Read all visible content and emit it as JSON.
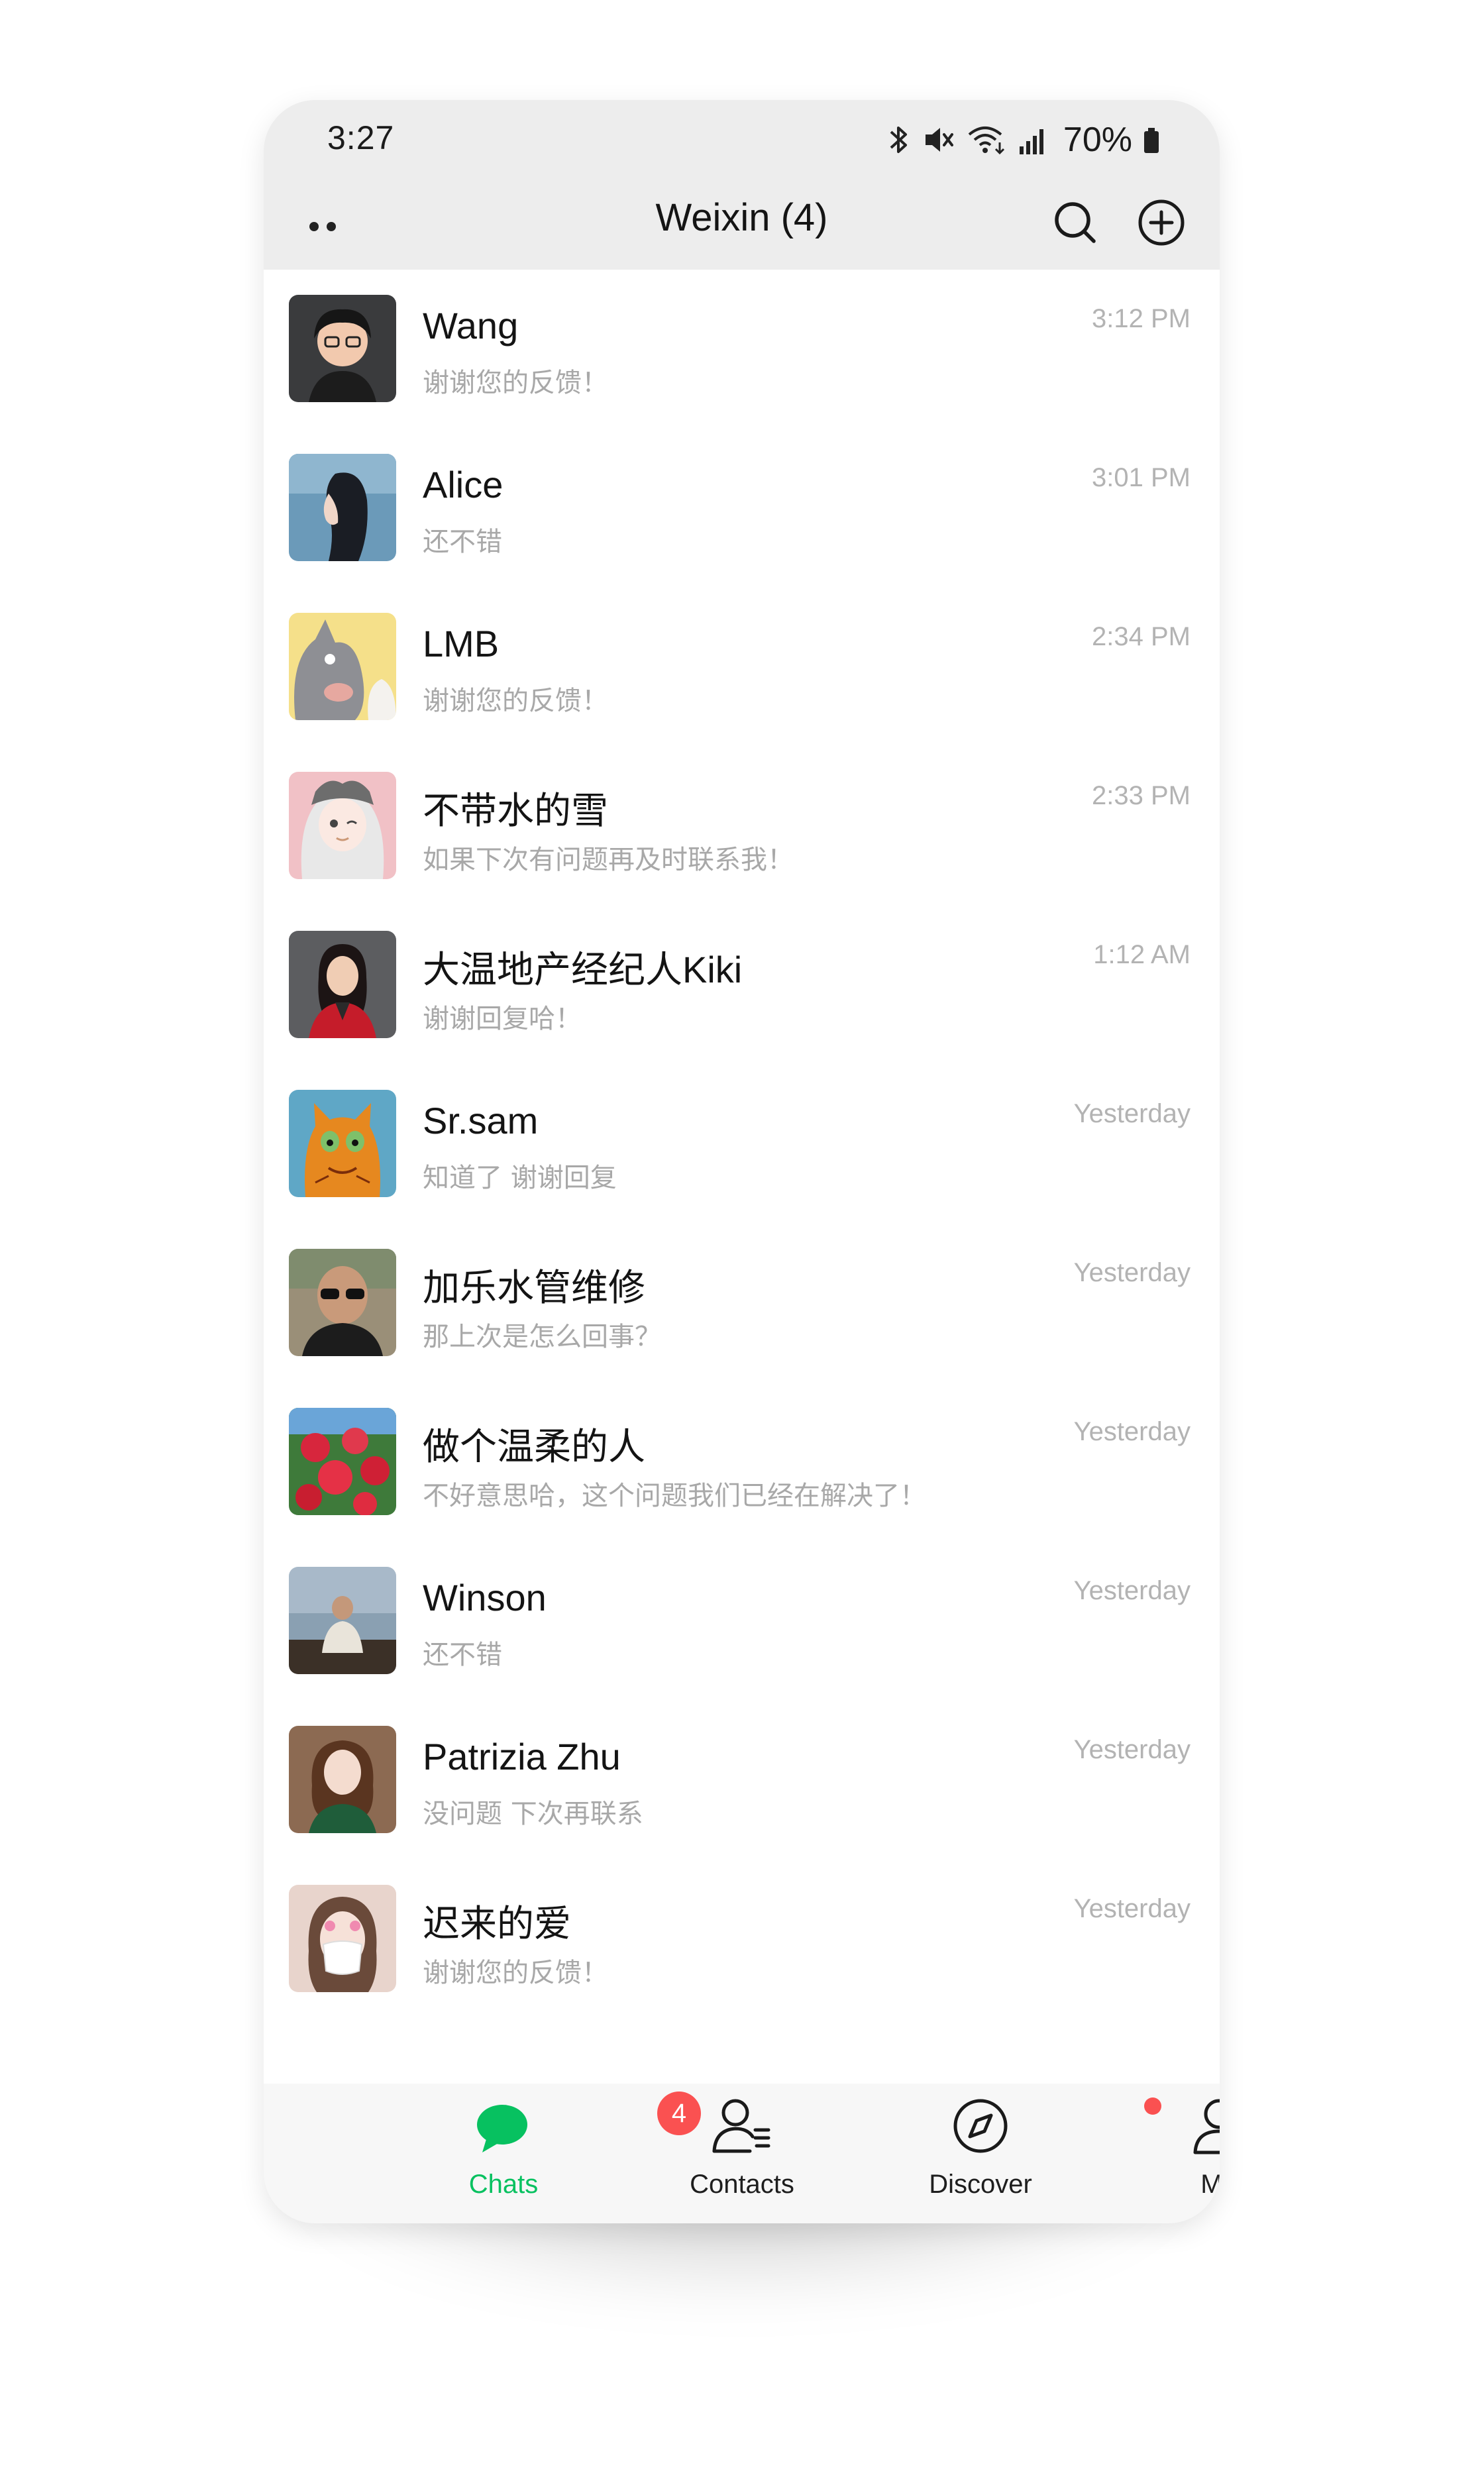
{
  "status_bar": {
    "time": "3:27",
    "battery": "70%"
  },
  "header": {
    "title": "Weixin (4)"
  },
  "chats": [
    {
      "name": "Wang",
      "message": "谢谢您的反馈！",
      "time": "3:12 PM",
      "avatar": "avatar-cartoon-woman"
    },
    {
      "name": "Alice",
      "message": "还不错",
      "time": "3:01 PM",
      "avatar": "avatar-woman-profile"
    },
    {
      "name": "LMB",
      "message": "谢谢您的反馈！",
      "time": "2:34 PM",
      "avatar": "avatar-cartoon-cat"
    },
    {
      "name": "不带水的雪",
      "message": "如果下次有问题再及时联系我！",
      "time": "2:33 PM",
      "avatar": "avatar-anime-girl"
    },
    {
      "name": "大温地产经纪人Kiki",
      "message": "谢谢回复哈！",
      "time": "1:12 AM",
      "avatar": "avatar-woman-red"
    },
    {
      "name": "Sr.sam",
      "message": "知道了 谢谢回复",
      "time": "Yesterday",
      "avatar": "avatar-painted-cat"
    },
    {
      "name": "加乐水管维修",
      "message": "那上次是怎么回事？",
      "time": "Yesterday",
      "avatar": "avatar-man-glasses"
    },
    {
      "name": "做个温柔的人",
      "message": "不好意思哈，这个问题我们已经在解决了！",
      "time": "Yesterday",
      "avatar": "avatar-roses"
    },
    {
      "name": "Winson",
      "message": "还不错",
      "time": "Yesterday",
      "avatar": "avatar-man-lake"
    },
    {
      "name": "Patrizia Zhu",
      "message": "没问题 下次再联系",
      "time": "Yesterday",
      "avatar": "avatar-woman-portrait"
    },
    {
      "name": "迟来的爱",
      "message": "谢谢您的反馈！",
      "time": "Yesterday",
      "avatar": "avatar-woman-mask"
    }
  ],
  "tabs": [
    {
      "label": "Chats",
      "icon": "chat-bubble-icon",
      "active": true,
      "badge": "4"
    },
    {
      "label": "Contacts",
      "icon": "contacts-icon",
      "active": false
    },
    {
      "label": "Discover",
      "icon": "compass-icon",
      "active": false
    },
    {
      "label": "Me",
      "icon": "person-icon",
      "active": false
    }
  ],
  "colors": {
    "accent": "#07c160",
    "badge": "#fa5151",
    "header_bg": "#ededed"
  }
}
